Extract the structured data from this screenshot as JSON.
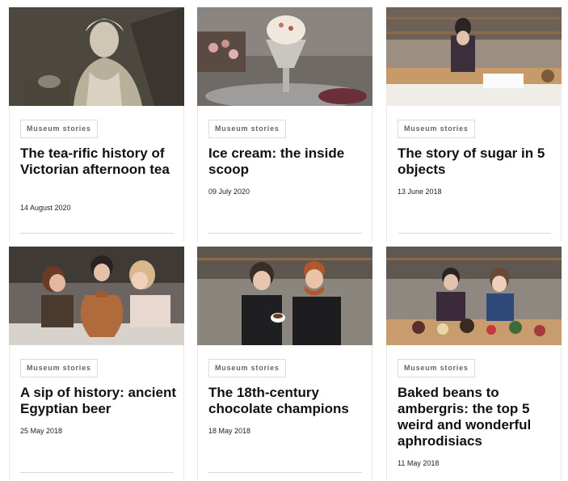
{
  "cards": [
    {
      "tag": "Museum stories",
      "title": "The tea-rific history of Victorian afternoon tea",
      "date": "14 August 2020"
    },
    {
      "tag": "Museum stories",
      "title": "Ice cream: the inside scoop",
      "date": "09 July 2020"
    },
    {
      "tag": "Museum stories",
      "title": "The story of sugar in 5 objects",
      "date": "13 June 2018"
    },
    {
      "tag": "Museum stories",
      "title": "A sip of history: ancient Egyptian beer",
      "date": "25 May 2018"
    },
    {
      "tag": "Museum stories",
      "title": "The 18th-century chocolate champions",
      "date": "18 May 2018"
    },
    {
      "tag": "Museum stories",
      "title": "Baked beans to ambergris: the top 5 weird and wonderful aphrodisiacs",
      "date": "11 May 2018"
    }
  ]
}
